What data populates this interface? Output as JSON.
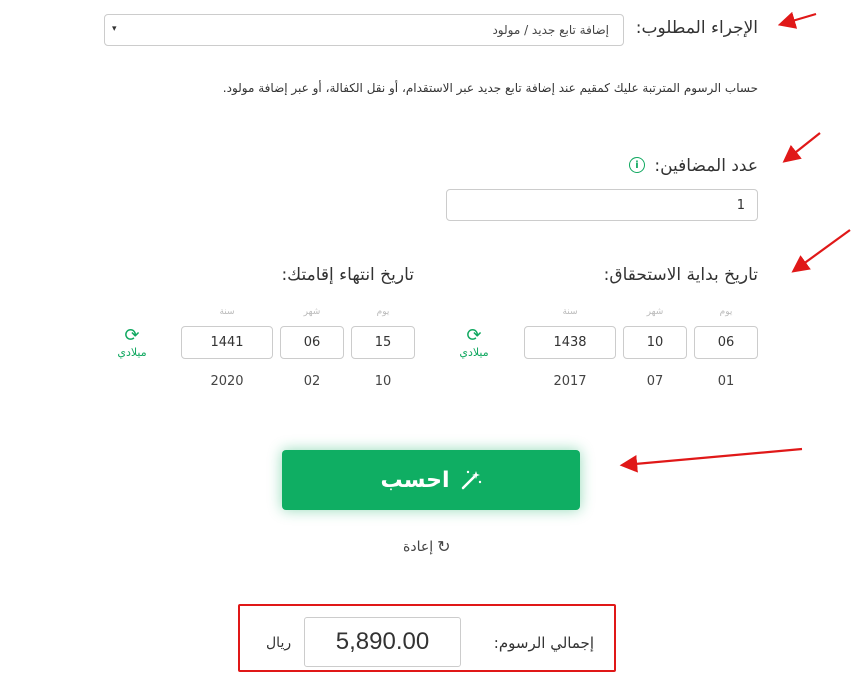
{
  "procedure": {
    "label": "الإجراء المطلوب:",
    "selected": "إضافة تابع جديد / مولود",
    "caret": "▾"
  },
  "description": "حساب الرسوم المترتبة عليك كمقيم عند إضافة تابع جديد عبر الاستقدام، أو نقل الكفالة، أو عبر إضافة مولود.",
  "dependents": {
    "label": "عدد المضافين:",
    "info_icon": "i",
    "value": "1"
  },
  "start_date": {
    "label": "تاريخ بداية الاستحقاق:",
    "hints": {
      "day": "يوم",
      "month": "شهر",
      "year": "سنة"
    },
    "hijri": {
      "day": "06",
      "month": "10",
      "year": "1438"
    },
    "gregorian": {
      "day": "01",
      "month": "07",
      "year": "2017"
    },
    "convert_label": "ميلادي"
  },
  "end_date": {
    "label": "تاريخ انتهاء إقامتك:",
    "hints": {
      "day": "يوم",
      "month": "شهر",
      "year": "سنة"
    },
    "hijri": {
      "day": "15",
      "month": "06",
      "year": "1441"
    },
    "gregorian": {
      "day": "10",
      "month": "02",
      "year": "2020"
    },
    "convert_label": "ميلادي"
  },
  "calculate": {
    "label": "احسب",
    "icon": "magic-wand-icon"
  },
  "reset": {
    "label": "إعادة"
  },
  "total": {
    "label": "إجمالي الرسوم:",
    "amount": "5,890.00",
    "currency": "ريال"
  },
  "colors": {
    "accent": "#0fae63",
    "annotation": "#e01818"
  }
}
